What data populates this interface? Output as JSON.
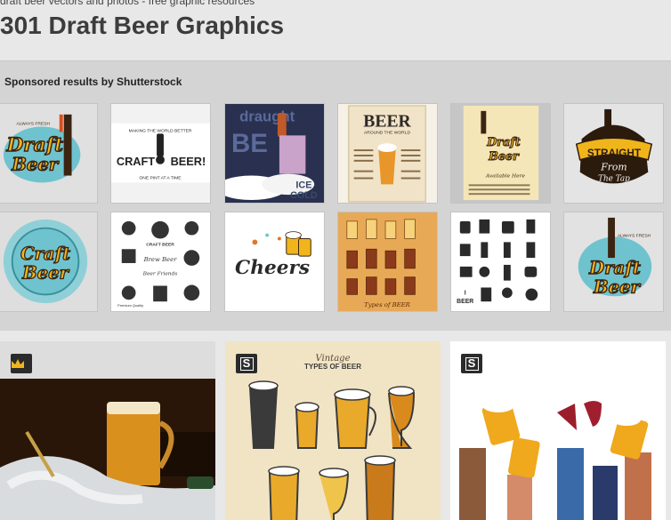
{
  "header": {
    "breadcrumb": "draft beer vectors and photos - free graphic resources",
    "title": "301 Draft Beer Graphics"
  },
  "sponsored": {
    "label": "Sponsored results by Shutterstock",
    "thumbnails": [
      {
        "text1": "Draft",
        "text2": "Beer",
        "text3": "ALWAYS FRESH"
      },
      {
        "text1": "CRAFT",
        "text2": "BEER!",
        "text3": "MAKING THE WORLD BETTER",
        "text4": "ONE PINT AT A TIME"
      },
      {
        "text1": "draught",
        "text2": "BE",
        "text3": "ICE",
        "text4": "COLD"
      },
      {
        "text1": "BEER",
        "text2": "AROUND THE WORLD"
      },
      {
        "text1": "Draft",
        "text2": "Beer",
        "text3": "Available Here"
      },
      {
        "text1": "STRAIGHT",
        "text2": "From",
        "text3": "The Tap"
      },
      {
        "text1": "Craft",
        "text2": "Beer"
      },
      {
        "text1": "CRAFT BEER",
        "text2": "Brew Beer",
        "text3": "Beer Friends",
        "text4": "Premium Quality"
      },
      {
        "text1": "Cheers"
      },
      {
        "text1": "Types of BEER"
      },
      {
        "text1": "I",
        "text2": "BEER"
      },
      {
        "text1": "Draft",
        "text2": "Beer",
        "text3": "ALWAYS FRESH"
      }
    ]
  },
  "results": [
    {
      "badge": "crown-icon",
      "type": "premium"
    },
    {
      "badge": "S",
      "type": "shutterstock",
      "poster_title": "Vintage",
      "poster_subtitle": "TYPES OF BEER"
    },
    {
      "badge": "S",
      "type": "shutterstock"
    }
  ],
  "colors": {
    "page_bg": "#e8e8e8",
    "sponsored_bg": "#d4d4d4",
    "gold": "#f1b51c",
    "dark_brown": "#3b2411",
    "teal": "#6fc3cf"
  }
}
